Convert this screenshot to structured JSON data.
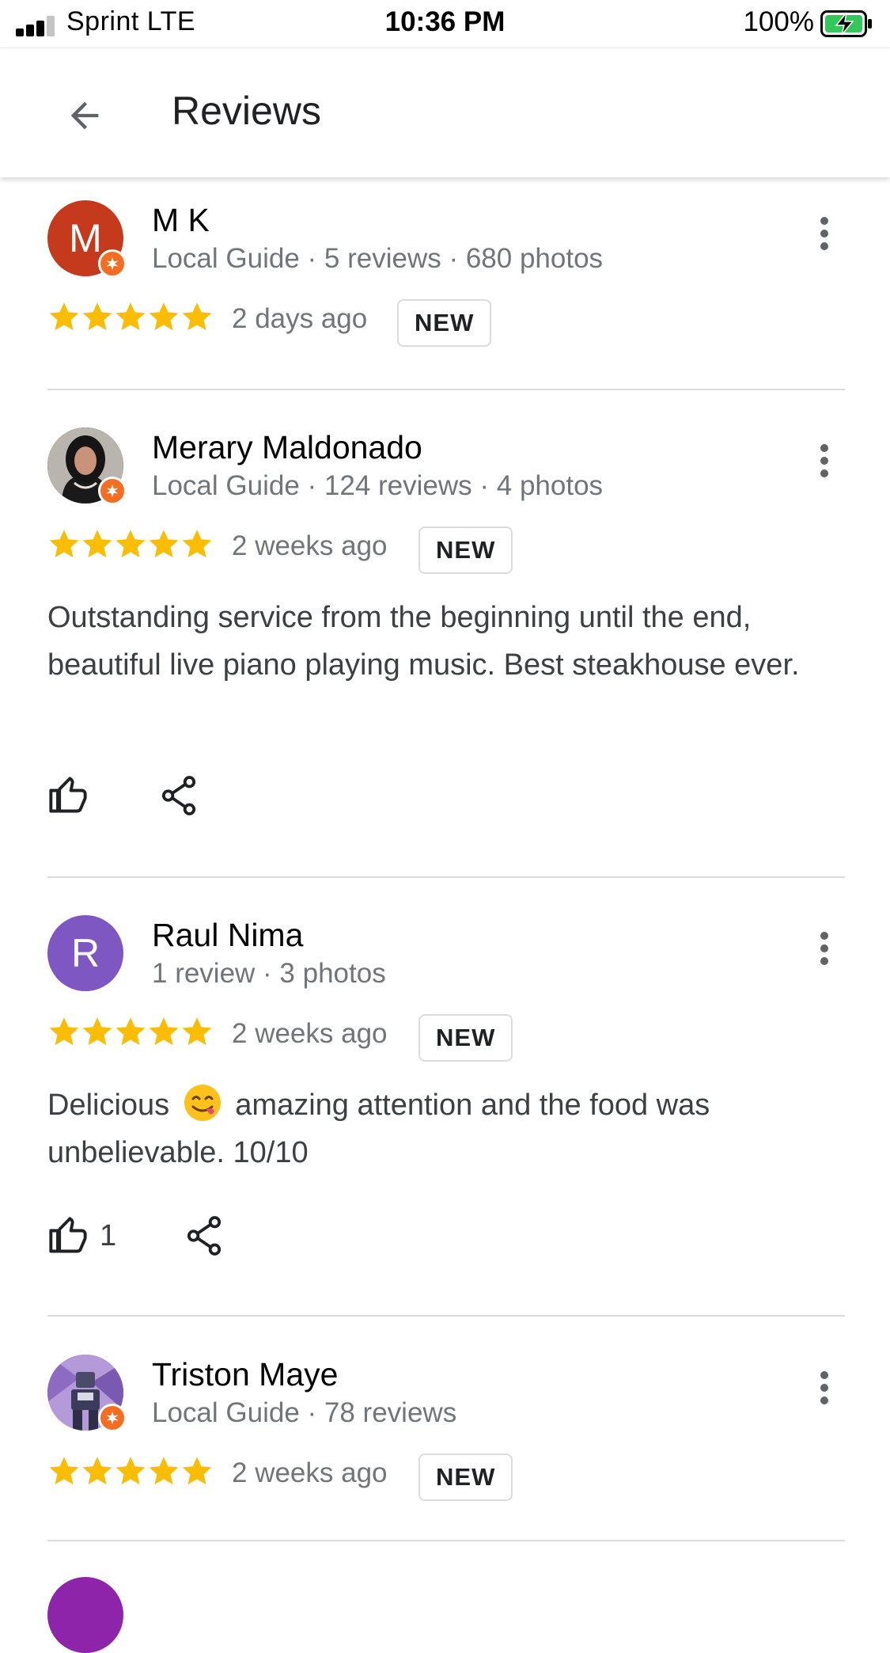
{
  "status_bar": {
    "carrier": "Sprint  LTE",
    "time": "10:36 PM",
    "battery": "100%",
    "battery_charging": true,
    "signal_bars_filled": 3,
    "signal_bars_total": 4
  },
  "app_bar": {
    "back_icon": "arrow-back-icon",
    "title": "Reviews"
  },
  "colors": {
    "star": "#fbbc04",
    "local_guide_badge": "#f36e22",
    "avatar_mk": "#c5391d",
    "avatar_raul": "#7e57c2",
    "avatar_peek": "#8e24aa",
    "battery_fill": "#34c759"
  },
  "reviews": [
    {
      "avatar_letter": "M",
      "name": "M K",
      "meta": "Local Guide · 5 reviews · 680 photos",
      "local_guide": true,
      "rating": 5,
      "date": "2 days ago",
      "badge": "NEW",
      "text": ""
    },
    {
      "avatar_letter": "",
      "name": "Merary Maldonado",
      "meta": "Local Guide · 124 reviews · 4 photos",
      "local_guide": true,
      "rating": 5,
      "date": "2 weeks ago",
      "badge": "NEW",
      "text": "Outstanding service from the beginning until the end, beautiful live piano playing music. Best steakhouse ever.",
      "likes": ""
    },
    {
      "avatar_letter": "R",
      "name": "Raul Nima",
      "meta": "1 review · 3 photos",
      "local_guide": false,
      "rating": 5,
      "date": "2 weeks ago",
      "badge": "NEW",
      "text_before_emoji": "Delicious",
      "text_after_emoji": "amazing attention and the food was unbelievable. 10/10",
      "emoji": "savoring-food-emoji",
      "likes": "1"
    },
    {
      "avatar_letter": "",
      "name": "Triston Maye",
      "meta": "Local Guide · 78 reviews",
      "local_guide": true,
      "rating": 5,
      "date": "2 weeks ago",
      "badge": "NEW",
      "text": ""
    }
  ]
}
